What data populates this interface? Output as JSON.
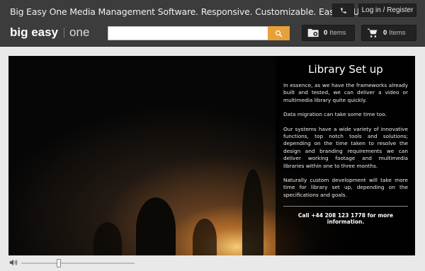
{
  "header": {
    "tagline": "Big Easy One Media Management Software. Responsive. Customizable. Easy to Use.",
    "login_label": "Log in / Register",
    "logo_main": "big easy",
    "logo_sub": "one",
    "search_placeholder": "",
    "folder_count": "0",
    "cart_count": "0",
    "items_label": "Items"
  },
  "player": {
    "title": "Library Set up",
    "paragraphs": [
      "In essence, as we have the frameworks already built and tested, we can deliver a video or multimedia library quite quickly.",
      "Data migration can take some time too.",
      "Our systems have a wide variety of innovative functions, top notch tools and solutions; depending on the time taken to resolve the design and branding requirements we can deliver working footage and multimedia libraries within one to three months.",
      "Naturally custom development will take more time for library set up, depending on the specifications and goals."
    ],
    "call_to_action": "Call +44 208 123 1778 for more information.",
    "volume_level": 0.33
  },
  "colors": {
    "header_bg": "#3c3c3c",
    "accent": "#e8a03a"
  },
  "icons": [
    "phone-icon",
    "search-icon",
    "folder-add-icon",
    "cart-icon",
    "volume-icon"
  ]
}
